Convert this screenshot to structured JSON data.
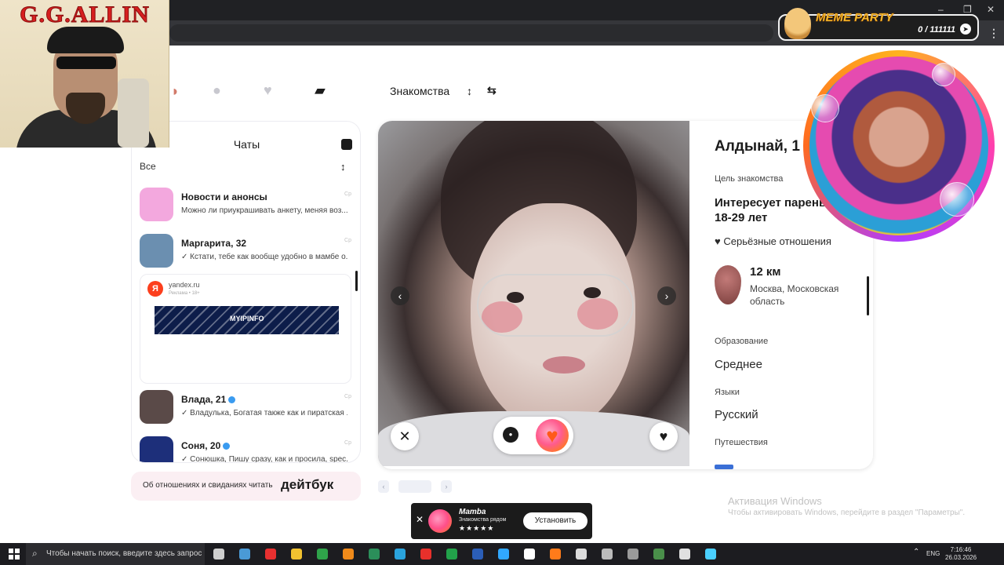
{
  "overlay": {
    "banner_title": "G.G.ALLIN",
    "meme_badge": {
      "title": "MEME PARTY",
      "counter": "0 / 111111"
    }
  },
  "browser": {
    "window_controls": [
      "–",
      "❐",
      "✕"
    ],
    "menu_icon": "⋮"
  },
  "app_nav": {
    "icons": [
      "avatar-icon",
      "search-icon",
      "hearts-icon",
      "cards-icon"
    ],
    "section_title": "Знакомства",
    "filter_icon": "↕",
    "swap_icon": "⇆"
  },
  "chats": {
    "title": "Чаты",
    "filter_label": "Все",
    "sort_icon": "↕",
    "items": [
      {
        "name": "Новости и анонсы",
        "message": "Можно ли приукрашивать анкету, меняя воз...",
        "time": "Ср",
        "avatar_color": "#f3a8de",
        "verified": false
      },
      {
        "name": "Маргарита, 32",
        "message": "✓ Кстати, тебе как вообще удобно в мамбе о...",
        "time": "Ср",
        "avatar_color": "#6b8fb0",
        "verified": false
      },
      {
        "name": "Влада, 21",
        "message": "✓ Владулька, Богатая также как и пиратская ...",
        "time": "Ср",
        "avatar_color": "#5a4a48",
        "verified": true
      },
      {
        "name": "Соня, 20",
        "message": "✓ Сонюшка, Пишу сразу, как и просила, spec...",
        "time": "Ср",
        "avatar_color": "#1d2f7a",
        "verified": true
      }
    ],
    "ad": {
      "logo": "Я",
      "domain": "yandex.ru",
      "label": "Реклама • 18+",
      "brand": "MYIPINFO"
    }
  },
  "dating_book": {
    "text": "Об отношениях и свиданиях читать",
    "logo": "дейтбук"
  },
  "profile": {
    "name": "Алдынай, 1",
    "goal_label": "Цель знакомства",
    "goal_value": "Интересует парень, 18-29 лет",
    "relationship": "Серьёзные отношения",
    "distance": "12 км",
    "location": "Москва, Московская область",
    "education_label": "Образование",
    "education_value": "Среднее",
    "languages_label": "Языки",
    "languages_value": "Русский",
    "travel_label": "Путешествия",
    "photo_prev": "‹",
    "photo_next": "›",
    "dislike_icon": "✕",
    "like_icon": "♥",
    "superlike_icon": "♥"
  },
  "pager": {
    "prev": "‹",
    "next": "›"
  },
  "windows_watermark": {
    "title": "Активация Windows",
    "subtitle": "Чтобы активировать Windows, перейдите в раздел \"Параметры\"."
  },
  "mamba_toast": {
    "close": "✕",
    "name": "Mamba",
    "description": "Знакомства рядом",
    "stars": "★★★★★",
    "install_label": "Установить"
  },
  "taskbar": {
    "search_placeholder": "Чтобы начать поиск, введите здесь запрос",
    "lang": "ENG",
    "time": "7:16:46",
    "date": "26.03.2026",
    "app_colors": [
      "#cfcfcf",
      "#4a9ad6",
      "#e83030",
      "#f2c230",
      "#2fa34a",
      "#f08a1a",
      "#2b8f5a",
      "#2aa3dd",
      "#e8302b",
      "#22a24a",
      "#2b5eb8",
      "#31a8ff",
      "#ffffff",
      "#ff7b1a",
      "#dcdcdc",
      "#bbbbbb",
      "#9a9a9a",
      "#4a8f4a",
      "#e0e0e0",
      "#4ad0ff"
    ]
  }
}
